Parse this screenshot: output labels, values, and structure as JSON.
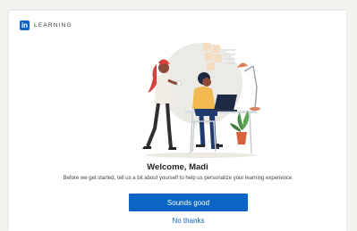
{
  "brand": {
    "logo_text": "in",
    "name": "LEARNING"
  },
  "welcome": {
    "title": "Welcome, Madi",
    "subtitle": "Before we get started, tell us a bit about yourself to help us personalize your learning experience"
  },
  "actions": {
    "primary_label": "Sounds good",
    "secondary_label": "No thanks"
  },
  "colors": {
    "brand_blue": "#0a66c2",
    "background": "#f3f2ef"
  }
}
